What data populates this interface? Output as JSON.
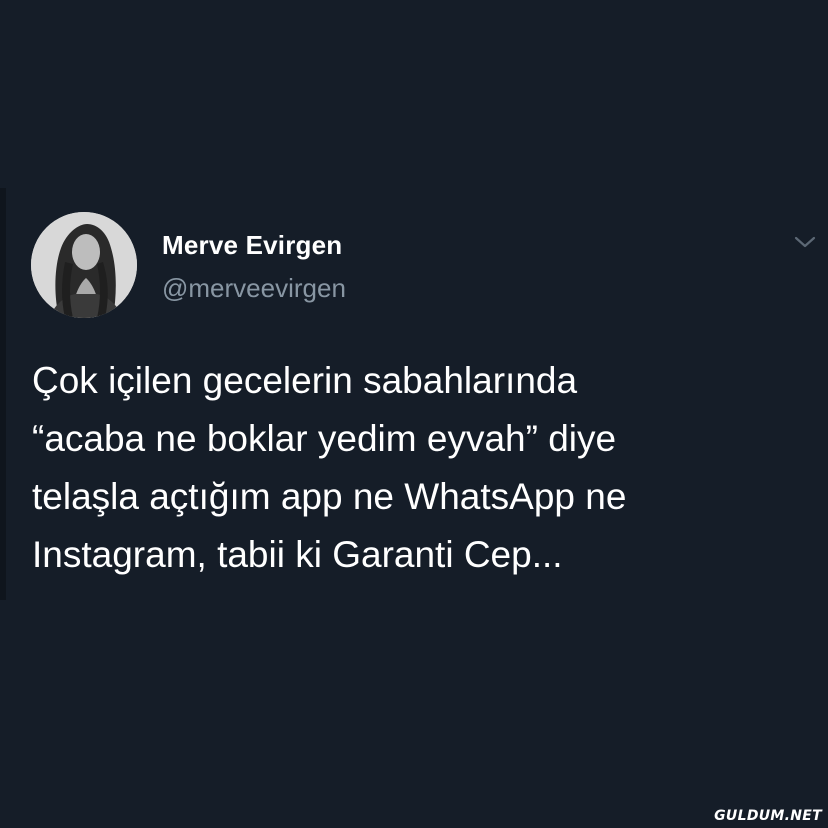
{
  "tweet": {
    "author": {
      "display_name": "Merve Evirgen",
      "handle": "@merveevirgen",
      "avatar_icon": "avatar-photo"
    },
    "menu_icon": "chevron-down-icon",
    "text": "Çok içilen gecelerin sabahlarında\n“acaba ne boklar yedim eyvah” diye\ntelaşla açtığım app ne WhatsApp ne\nInstagram, tabii ki Garanti Cep..."
  },
  "watermark": {
    "label": "GULDUM.NET"
  },
  "colors": {
    "background": "#151d28",
    "text_primary": "#ffffff",
    "text_secondary": "#8896a3"
  }
}
